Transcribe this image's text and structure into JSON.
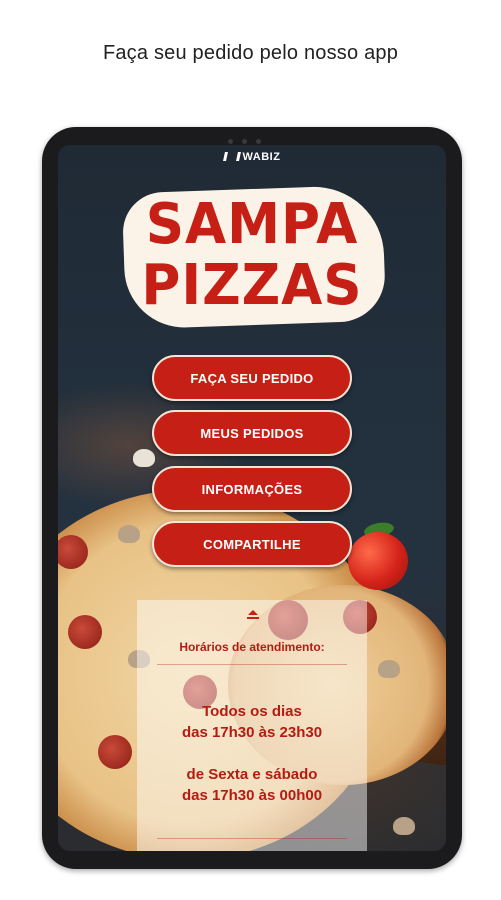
{
  "caption": "Faça seu pedido pelo nosso app",
  "app": {
    "brand": "WABIZ",
    "logo_line1": "SAMPA",
    "logo_line2": "PIZZAS"
  },
  "menu": {
    "items": [
      {
        "label": "FAÇA SEU PEDIDO"
      },
      {
        "label": "MEUS PEDIDOS"
      },
      {
        "label": "INFORMAÇÕES"
      },
      {
        "label": "COMPARTILHE"
      }
    ]
  },
  "info": {
    "title": "Horários de atendimento:",
    "schedule": [
      {
        "days": "Todos os dias",
        "hours": "das 17h30 às 23h30"
      },
      {
        "days": "de Sexta e sábado",
        "hours": "das 17h30 às 00h00"
      }
    ]
  },
  "colors": {
    "accent": "#c62016",
    "screen_bg": "#222c36",
    "button_border": "#f3e6d8"
  }
}
